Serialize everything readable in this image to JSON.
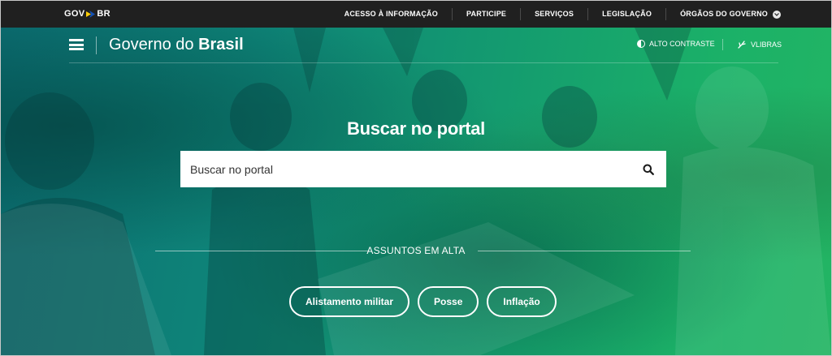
{
  "topbar": {
    "logo_gov": "GOV",
    "logo_br": "BR",
    "nav": [
      {
        "label": "ACESSO À INFORMAÇÃO"
      },
      {
        "label": "PARTICIPE"
      },
      {
        "label": "SERVIÇOS"
      },
      {
        "label": "LEGISLAÇÃO"
      },
      {
        "label": "ÓRGÃOS DO GOVERNO"
      }
    ]
  },
  "header": {
    "brand_prefix": "Governo do ",
    "brand_strong": "Brasil",
    "contrast_label": "ALTO CONTRASTE",
    "vlibras_label": "VLIBRAS"
  },
  "hero": {
    "title": "Buscar no portal",
    "search_placeholder": "Buscar no portal",
    "trending_label": "ASSUNTOS EM ALTA",
    "chips": [
      {
        "label": "Alistamento militar"
      },
      {
        "label": "Posse"
      },
      {
        "label": "Inflação"
      }
    ]
  },
  "colors": {
    "topbar_bg": "#202020",
    "hero_teal": "#0e8478",
    "hero_green": "#1bb168",
    "arrow_yellow": "#ffcd07",
    "arrow_blue": "#1351b4"
  }
}
